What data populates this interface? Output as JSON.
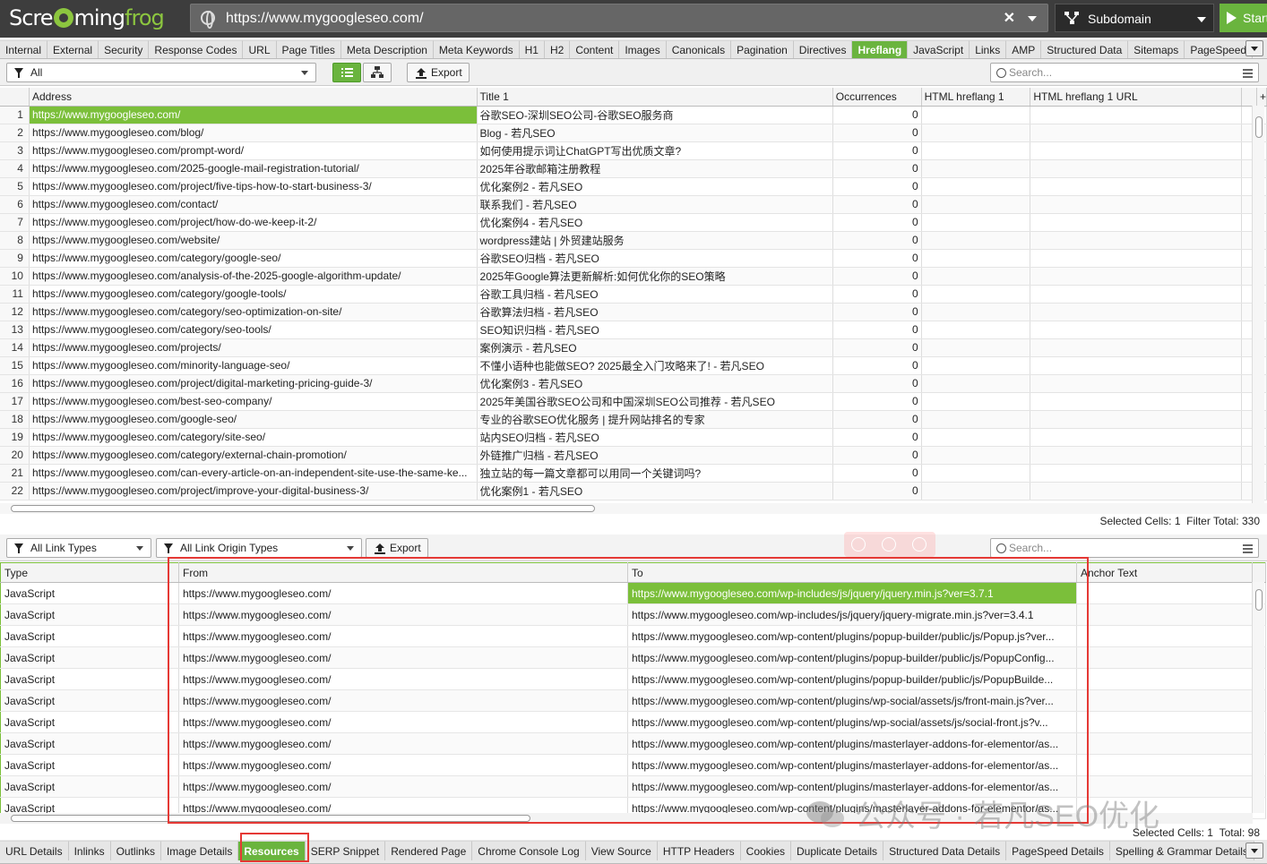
{
  "app": {
    "logo_part1": "Scre",
    "logo_part2": "ming",
    "logo_part3": "frog",
    "url": "https://www.mygoogleseo.com/",
    "mode": "Subdomain",
    "start_label": "Start"
  },
  "top_tabs": [
    "Internal",
    "External",
    "Security",
    "Response Codes",
    "URL",
    "Page Titles",
    "Meta Description",
    "Meta Keywords",
    "H1",
    "H2",
    "Content",
    "Images",
    "Canonicals",
    "Pagination",
    "Directives",
    "Hreflang",
    "JavaScript",
    "Links",
    "AMP",
    "Structured Data",
    "Sitemaps",
    "PageSpeed"
  ],
  "active_top_tab": "Hreflang",
  "filter": {
    "value": "All",
    "export_label": "Export",
    "search_placeholder": "Search..."
  },
  "main_table": {
    "columns": [
      "Address",
      "Title 1",
      "Occurrences",
      "HTML hreflang 1",
      "HTML hreflang 1 URL"
    ],
    "rows": [
      {
        "n": "1",
        "address": "https://www.mygoogleseo.com/",
        "title": "谷歌SEO-深圳SEO公司-谷歌SEO服务商",
        "occ": "0"
      },
      {
        "n": "2",
        "address": "https://www.mygoogleseo.com/blog/",
        "title": "Blog - 若凡SEO",
        "occ": "0"
      },
      {
        "n": "3",
        "address": "https://www.mygoogleseo.com/prompt-word/",
        "title": "如何使用提示词让ChatGPT写出优质文章?",
        "occ": "0"
      },
      {
        "n": "4",
        "address": "https://www.mygoogleseo.com/2025-google-mail-registration-tutorial/",
        "title": "2025年谷歌邮箱注册教程",
        "occ": "0"
      },
      {
        "n": "5",
        "address": "https://www.mygoogleseo.com/project/five-tips-how-to-start-business-3/",
        "title": "优化案例2 - 若凡SEO",
        "occ": "0"
      },
      {
        "n": "6",
        "address": "https://www.mygoogleseo.com/contact/",
        "title": "联系我们 - 若凡SEO",
        "occ": "0"
      },
      {
        "n": "7",
        "address": "https://www.mygoogleseo.com/project/how-do-we-keep-it-2/",
        "title": "优化案例4 - 若凡SEO",
        "occ": "0"
      },
      {
        "n": "8",
        "address": "https://www.mygoogleseo.com/website/",
        "title": "wordpress建站 | 外贸建站服务",
        "occ": "0"
      },
      {
        "n": "9",
        "address": "https://www.mygoogleseo.com/category/google-seo/",
        "title": "谷歌SEO归档 - 若凡SEO",
        "occ": "0"
      },
      {
        "n": "10",
        "address": "https://www.mygoogleseo.com/analysis-of-the-2025-google-algorithm-update/",
        "title": "2025年Google算法更新解析:如何优化你的SEO策略",
        "occ": "0"
      },
      {
        "n": "11",
        "address": "https://www.mygoogleseo.com/category/google-tools/",
        "title": "谷歌工具归档 - 若凡SEO",
        "occ": "0"
      },
      {
        "n": "12",
        "address": "https://www.mygoogleseo.com/category/seo-optimization-on-site/",
        "title": "谷歌算法归档 - 若凡SEO",
        "occ": "0"
      },
      {
        "n": "13",
        "address": "https://www.mygoogleseo.com/category/seo-tools/",
        "title": "SEO知识归档 - 若凡SEO",
        "occ": "0"
      },
      {
        "n": "14",
        "address": "https://www.mygoogleseo.com/projects/",
        "title": "案例演示 - 若凡SEO",
        "occ": "0"
      },
      {
        "n": "15",
        "address": "https://www.mygoogleseo.com/minority-language-seo/",
        "title": "不懂小语种也能做SEO? 2025最全入门攻略来了! - 若凡SEO",
        "occ": "0"
      },
      {
        "n": "16",
        "address": "https://www.mygoogleseo.com/project/digital-marketing-pricing-guide-3/",
        "title": "优化案例3 - 若凡SEO",
        "occ": "0"
      },
      {
        "n": "17",
        "address": "https://www.mygoogleseo.com/best-seo-company/",
        "title": "2025年美国谷歌SEO公司和中国深圳SEO公司推荐 - 若凡SEO",
        "occ": "0"
      },
      {
        "n": "18",
        "address": "https://www.mygoogleseo.com/google-seo/",
        "title": "专业的谷歌SEO优化服务 | 提升网站排名的专家",
        "occ": "0"
      },
      {
        "n": "19",
        "address": "https://www.mygoogleseo.com/category/site-seo/",
        "title": "站内SEO归档 - 若凡SEO",
        "occ": "0"
      },
      {
        "n": "20",
        "address": "https://www.mygoogleseo.com/category/external-chain-promotion/",
        "title": "外链推广归档 - 若凡SEO",
        "occ": "0"
      },
      {
        "n": "21",
        "address": "https://www.mygoogleseo.com/can-every-article-on-an-independent-site-use-the-same-ke...",
        "title": "独立站的每一篇文章都可以用同一个关键词吗?",
        "occ": "0"
      },
      {
        "n": "22",
        "address": "https://www.mygoogleseo.com/project/improve-your-digital-business-3/",
        "title": "优化案例1 - 若凡SEO",
        "occ": "0"
      }
    ],
    "status_selected": "Selected Cells:  1",
    "status_total": "Filter Total:  330"
  },
  "lower_toolbar": {
    "link_types": "All Link Types",
    "origin_types": "All Link Origin Types",
    "export_label": "Export",
    "search_placeholder": "Search..."
  },
  "resources_table": {
    "columns": [
      "Type",
      "From",
      "To",
      "Anchor Text"
    ],
    "rows": [
      {
        "type": "JavaScript",
        "from": "https://www.mygoogleseo.com/",
        "to": "https://www.mygoogleseo.com/wp-includes/js/jquery/jquery.min.js?ver=3.7.1"
      },
      {
        "type": "JavaScript",
        "from": "https://www.mygoogleseo.com/",
        "to": "https://www.mygoogleseo.com/wp-includes/js/jquery/jquery-migrate.min.js?ver=3.4.1"
      },
      {
        "type": "JavaScript",
        "from": "https://www.mygoogleseo.com/",
        "to": "https://www.mygoogleseo.com/wp-content/plugins/popup-builder/public/js/Popup.js?ver..."
      },
      {
        "type": "JavaScript",
        "from": "https://www.mygoogleseo.com/",
        "to": "https://www.mygoogleseo.com/wp-content/plugins/popup-builder/public/js/PopupConfig..."
      },
      {
        "type": "JavaScript",
        "from": "https://www.mygoogleseo.com/",
        "to": "https://www.mygoogleseo.com/wp-content/plugins/popup-builder/public/js/PopupBuilde..."
      },
      {
        "type": "JavaScript",
        "from": "https://www.mygoogleseo.com/",
        "to": "https://www.mygoogleseo.com/wp-content/plugins/wp-social/assets/js/front-main.js?ver..."
      },
      {
        "type": "JavaScript",
        "from": "https://www.mygoogleseo.com/",
        "to": "https://www.mygoogleseo.com/wp-content/plugins/wp-social/assets/js/social-front.js?v..."
      },
      {
        "type": "JavaScript",
        "from": "https://www.mygoogleseo.com/",
        "to": "https://www.mygoogleseo.com/wp-content/plugins/masterlayer-addons-for-elementor/as..."
      },
      {
        "type": "JavaScript",
        "from": "https://www.mygoogleseo.com/",
        "to": "https://www.mygoogleseo.com/wp-content/plugins/masterlayer-addons-for-elementor/as..."
      },
      {
        "type": "JavaScript",
        "from": "https://www.mygoogleseo.com/",
        "to": "https://www.mygoogleseo.com/wp-content/plugins/masterlayer-addons-for-elementor/as..."
      },
      {
        "type": "JavaScript",
        "from": "https://www.mygoogleseo.com/",
        "to": "https://www.mygoogleseo.com/wp-content/plugins/masterlayer-addons-for-elementor/as..."
      }
    ],
    "status_selected": "Selected Cells:  1",
    "status_total": "Total:  98"
  },
  "bottom_tabs": [
    "URL Details",
    "Inlinks",
    "Outlinks",
    "Image Details",
    "Resources",
    "SERP Snippet",
    "Rendered Page",
    "Chrome Console Log",
    "View Source",
    "HTTP Headers",
    "Cookies",
    "Duplicate Details",
    "Structured Data Details",
    "PageSpeed Details",
    "Spelling & Grammar Details"
  ],
  "active_bottom_tab": "Resources",
  "watermark": "公众号 · 若凡SEO优化",
  "colors": {
    "accent": "#6ab43e",
    "topbar": "#3d3d3d",
    "highlight": "#e53935"
  }
}
